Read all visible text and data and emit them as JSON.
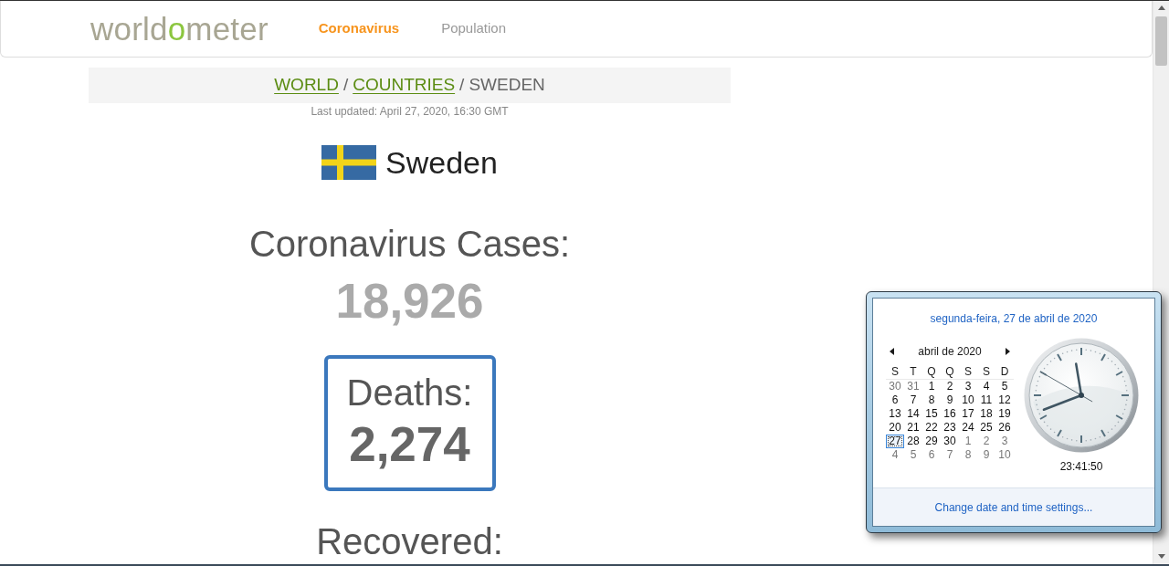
{
  "header": {
    "logo": {
      "start": "world",
      "accent": "o",
      "end": "meter"
    },
    "nav": [
      {
        "label": "Coronavirus",
        "selected": true
      },
      {
        "label": "Population",
        "selected": false
      }
    ]
  },
  "breadcrumb": [
    {
      "kind": "link",
      "text": "WORLD"
    },
    {
      "kind": "separator",
      "text": "/"
    },
    {
      "kind": "link",
      "text": "COUNTRIES"
    },
    {
      "kind": "separator",
      "text": "/"
    },
    {
      "kind": "current",
      "text": "SWEDEN"
    }
  ],
  "last_updated": "Last updated: April 27, 2020, 16:30 GMT",
  "country": {
    "name": "Sweden"
  },
  "stats": [
    {
      "kind": "plain",
      "label": "Coronavirus Cases:",
      "value": "18,926"
    },
    {
      "kind": "boxed",
      "label": "Deaths:",
      "value": "2,274"
    },
    {
      "kind": "plain",
      "label": "Recovered:"
    }
  ],
  "date_popup": {
    "date_link": "segunda-feira, 27 de abril de 2020",
    "calendar": {
      "month": "abril de 2020",
      "weekdays": [
        "S",
        "T",
        "Q",
        "Q",
        "S",
        "S",
        "D"
      ],
      "weeks": [
        [
          {
            "day": "30",
            "current_month": false,
            "selected": false
          },
          {
            "day": "31",
            "current_month": false,
            "selected": false
          },
          {
            "day": "1",
            "current_month": true,
            "selected": false
          },
          {
            "day": "2",
            "current_month": true,
            "selected": false
          },
          {
            "day": "3",
            "current_month": true,
            "selected": false
          },
          {
            "day": "4",
            "current_month": true,
            "selected": false
          },
          {
            "day": "5",
            "current_month": true,
            "selected": false
          }
        ],
        [
          {
            "day": "6",
            "current_month": true,
            "selected": false
          },
          {
            "day": "7",
            "current_month": true,
            "selected": false
          },
          {
            "day": "8",
            "current_month": true,
            "selected": false
          },
          {
            "day": "9",
            "current_month": true,
            "selected": false
          },
          {
            "day": "10",
            "current_month": true,
            "selected": false
          },
          {
            "day": "11",
            "current_month": true,
            "selected": false
          },
          {
            "day": "12",
            "current_month": true,
            "selected": false
          }
        ],
        [
          {
            "day": "13",
            "current_month": true,
            "selected": false
          },
          {
            "day": "14",
            "current_month": true,
            "selected": false
          },
          {
            "day": "15",
            "current_month": true,
            "selected": false
          },
          {
            "day": "16",
            "current_month": true,
            "selected": false
          },
          {
            "day": "17",
            "current_month": true,
            "selected": false
          },
          {
            "day": "18",
            "current_month": true,
            "selected": false
          },
          {
            "day": "19",
            "current_month": true,
            "selected": false
          }
        ],
        [
          {
            "day": "20",
            "current_month": true,
            "selected": false
          },
          {
            "day": "21",
            "current_month": true,
            "selected": false
          },
          {
            "day": "22",
            "current_month": true,
            "selected": false
          },
          {
            "day": "23",
            "current_month": true,
            "selected": false
          },
          {
            "day": "24",
            "current_month": true,
            "selected": false
          },
          {
            "day": "25",
            "current_month": true,
            "selected": false
          },
          {
            "day": "26",
            "current_month": true,
            "selected": false
          }
        ],
        [
          {
            "day": "27",
            "current_month": true,
            "selected": true
          },
          {
            "day": "28",
            "current_month": true,
            "selected": false
          },
          {
            "day": "29",
            "current_month": true,
            "selected": false
          },
          {
            "day": "30",
            "current_month": true,
            "selected": false
          },
          {
            "day": "1",
            "current_month": false,
            "selected": false
          },
          {
            "day": "2",
            "current_month": false,
            "selected": false
          },
          {
            "day": "3",
            "current_month": false,
            "selected": false
          }
        ],
        [
          {
            "day": "4",
            "current_month": false,
            "selected": false
          },
          {
            "day": "5",
            "current_month": false,
            "selected": false
          },
          {
            "day": "6",
            "current_month": false,
            "selected": false
          },
          {
            "day": "7",
            "current_month": false,
            "selected": false
          },
          {
            "day": "8",
            "current_month": false,
            "selected": false
          },
          {
            "day": "9",
            "current_month": false,
            "selected": false
          },
          {
            "day": "10",
            "current_month": false,
            "selected": false
          }
        ]
      ]
    },
    "clock": {
      "time": "23:41:50"
    },
    "settings_link": "Change date and time settings..."
  }
}
